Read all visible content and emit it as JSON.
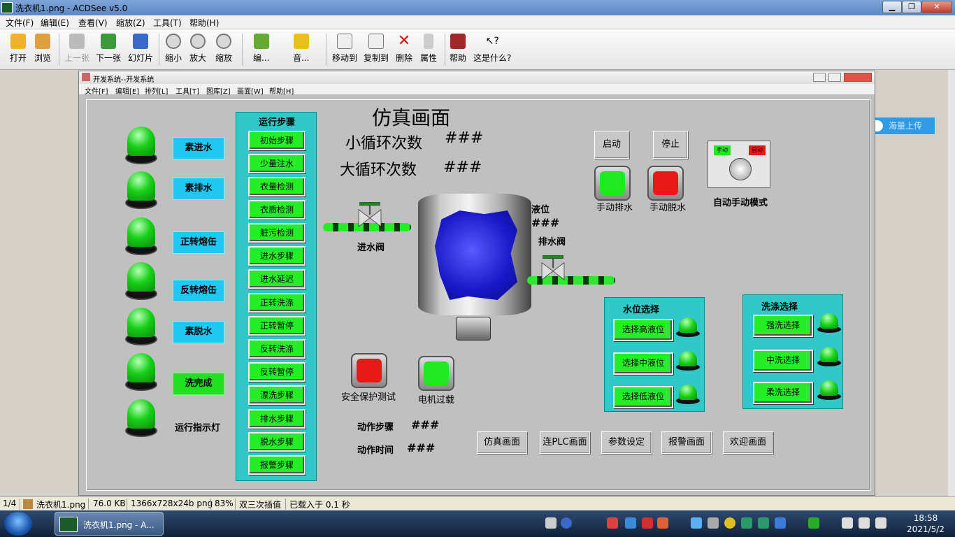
{
  "window": {
    "title": "洗衣机1.png - ACDSee v5.0"
  },
  "menu": [
    "文件(F)",
    "编辑(E)",
    "查看(V)",
    "缩放(Z)",
    "工具(T)",
    "帮助(H)"
  ],
  "toolbar": [
    "打开",
    "浏览",
    "上一张",
    "下一张",
    "幻灯片",
    "缩小",
    "放大",
    "缩放",
    "编...",
    "音...",
    "移动到",
    "复制到",
    "删除",
    "属性",
    "帮助",
    "这是什么?"
  ],
  "inner": {
    "title": "开发系统--开发系统",
    "menu": [
      "文件[F]",
      "编辑[E]",
      "排列[L]",
      "工具[T]",
      "图库[Z]",
      "画面[W]",
      "帮助[H]"
    ]
  },
  "scada": {
    "title": "仿真画面",
    "small_cycle": "小循环次数",
    "small_cycle_val": "###",
    "big_cycle": "大循环次数",
    "big_cycle_val": "###",
    "left_labels": [
      "素进水",
      "素排水",
      "正转熔缶",
      "反转熔缶",
      "素脱水"
    ],
    "done_label": "洗完成",
    "run_lamp_label": "运行指示灯",
    "step_title": "运行步骤",
    "steps": [
      "初始步骤",
      "少量注水",
      "衣量检测",
      "衣质检测",
      "脏污检测",
      "进水步骤",
      "进水延迟",
      "正转洗涤",
      "正转暂停",
      "反转洗涤",
      "反转暂停",
      "漂洗步骤",
      "排水步骤",
      "脱水步骤",
      "报警步骤"
    ],
    "inlet_valve": "进水阀",
    "level_label": "液位",
    "level_val": "###",
    "drain_valve": "排水阀",
    "start_btn": "启动",
    "stop_btn": "停止",
    "manual_drain": "手动排水",
    "manual_spin": "手动脱水",
    "mode_manual": "手动",
    "mode_auto": "自动",
    "mode_label": "自动手动模式",
    "safety_label": "安全保护测试",
    "overload_label": "电机过载",
    "action_step": "动作步骤",
    "action_step_val": "###",
    "action_time": "动作时间",
    "action_time_val": "###",
    "water_title": "水位选择",
    "water_opts": [
      "选择高液位",
      "选择中液位",
      "选择低液位"
    ],
    "wash_title": "洗涤选择",
    "wash_opts": [
      "强洗选择",
      "中洗选择",
      "柔洗选择"
    ],
    "nav": [
      "仿真画面",
      "连PLC画面",
      "参数设定",
      "报警画面",
      "欢迎画面"
    ]
  },
  "cloud": "海量上传",
  "status": {
    "index": "1/4",
    "file": "洗衣机1.png",
    "size": "76.0 KB",
    "dims": "1366x728x24b png",
    "zoom": "83%",
    "interp": "双三次插值",
    "loaded": "已载入于 0.1 秒"
  },
  "taskbar": {
    "item": "洗衣机1.png - A...",
    "time": "18:58",
    "date": "2021/5/2"
  },
  "colors": {
    "lamp_green": "#18d018",
    "panel_cyan": "#32c8c8",
    "label_cyan": "#1ec8f0",
    "btn_red": "#e81818"
  }
}
